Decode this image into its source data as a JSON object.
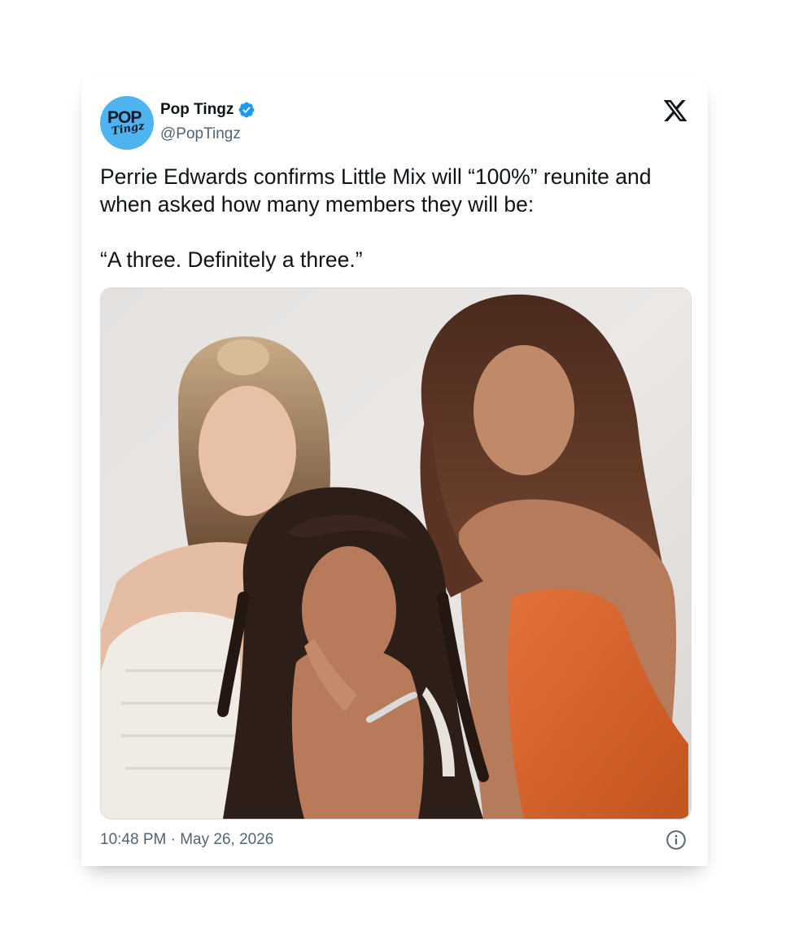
{
  "tweet": {
    "author": {
      "display_name": "Pop Tingz",
      "handle": "@PopTingz",
      "verified": true,
      "avatar_text_top": "POP",
      "avatar_text_bottom": "Tingz",
      "avatar_color": "#4fb3ef"
    },
    "text": "Perrie Edwards confirms Little Mix will “100%” reunite and when asked how many members they will be:\n\n“A three. Definitely a three.”",
    "media": {
      "icon": "photo-three-women"
    },
    "timestamp": "10:48 PM · May 26, 2026",
    "platform_icon": "x-logo-icon",
    "info_icon": "info-icon"
  },
  "colors": {
    "text_primary": "#0f1419",
    "text_secondary": "#536471",
    "verified_blue": "#1d9bf0"
  }
}
